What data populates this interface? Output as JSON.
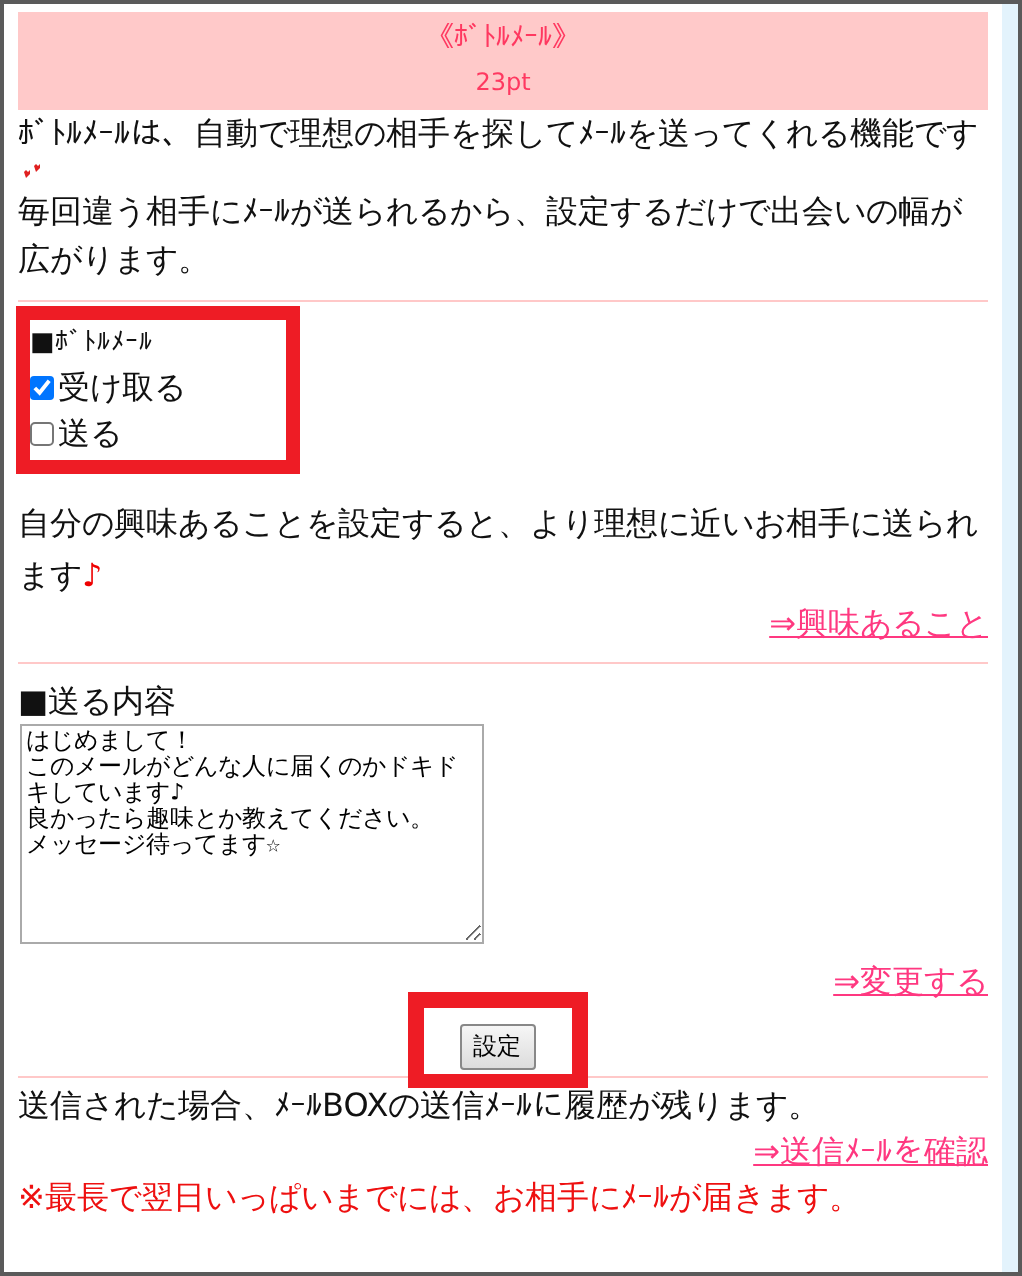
{
  "header": {
    "title": "《ﾎﾞﾄﾙﾒｰﾙ》",
    "points": "23pt"
  },
  "intro": {
    "text": "ﾎﾞﾄﾙﾒｰﾙは、自動で理想の相手を探してﾒｰﾙを送ってくれる機能です",
    "text2": "毎回違う相手にﾒｰﾙが送られるから、設定するだけで出会いの幅が広がります。"
  },
  "bottle_mail": {
    "heading": "■ﾎﾞﾄﾙﾒｰﾙ",
    "options": [
      {
        "label": "受け取る",
        "checked": true
      },
      {
        "label": "送る",
        "checked": false
      }
    ]
  },
  "interest": {
    "text": "自分の興味あることを設定すると、より理想に近いお相手に送られます",
    "note": "♪",
    "link": "⇒興味あること"
  },
  "message": {
    "heading": "■送る内容",
    "lines": [
      "はじめまして！",
      "このメールがどんな人に届くのかドキドキしています♪",
      "良かったら趣味とか教えてください。",
      "メッセージ待ってます☆"
    ],
    "link": "⇒変更する"
  },
  "submit": "設定",
  "footer": {
    "text": "送信された場合、ﾒｰﾙBOXの送信ﾒｰﾙに履歴が残ります。",
    "link": "⇒送信ﾒｰﾙを確認",
    "warning": "※最長で翌日いっぱいまでには、お相手にﾒｰﾙが届きます。"
  }
}
